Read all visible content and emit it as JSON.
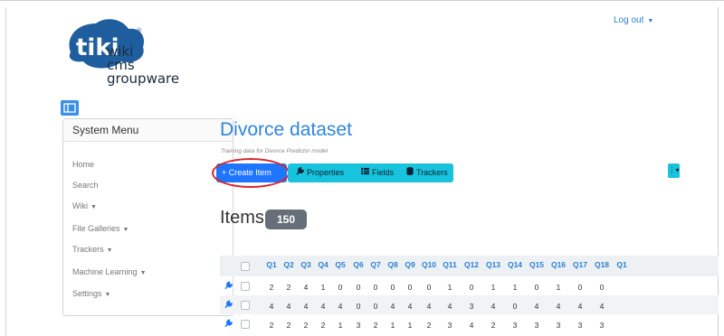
{
  "header": {
    "logout_label": "Log out"
  },
  "logo": {
    "brand": "tiki",
    "mark": "®",
    "lines": [
      "wiki",
      "cms",
      "groupware"
    ]
  },
  "sidebar": {
    "title": "System Menu",
    "items": [
      {
        "label": "Home",
        "has_caret": false
      },
      {
        "label": "Search",
        "has_caret": false
      },
      {
        "label": "Wiki",
        "has_caret": true
      },
      {
        "label": "File Galleries",
        "has_caret": true
      },
      {
        "label": "Trackers",
        "has_caret": true
      },
      {
        "label": "Machine Learning",
        "has_caret": true
      },
      {
        "label": "Settings",
        "has_caret": true
      }
    ]
  },
  "page": {
    "title": "Divorce dataset",
    "subtitle": "Training data for Divorce Predictor model"
  },
  "toolbar": {
    "create_label": "+ Create Item",
    "properties_label": "Properties",
    "fields_label": "Fields",
    "trackers_label": "Trackers"
  },
  "items": {
    "title": "Items",
    "count": "150"
  },
  "table": {
    "columns": [
      "Q1",
      "Q2",
      "Q3",
      "Q4",
      "Q5",
      "Q6",
      "Q7",
      "Q8",
      "Q9",
      "Q10",
      "Q11",
      "Q12",
      "Q13",
      "Q14",
      "Q15",
      "Q16",
      "Q17",
      "Q18",
      "Q1"
    ],
    "rows": [
      [
        "2",
        "2",
        "4",
        "1",
        "0",
        "0",
        "0",
        "0",
        "0",
        "0",
        "1",
        "0",
        "1",
        "1",
        "0",
        "1",
        "0",
        "0",
        ""
      ],
      [
        "4",
        "4",
        "4",
        "4",
        "4",
        "0",
        "0",
        "4",
        "4",
        "4",
        "4",
        "3",
        "4",
        "0",
        "4",
        "4",
        "4",
        "4",
        ""
      ],
      [
        "2",
        "2",
        "2",
        "2",
        "1",
        "3",
        "2",
        "1",
        "1",
        "2",
        "3",
        "4",
        "2",
        "3",
        "3",
        "3",
        "3",
        "3",
        ""
      ]
    ]
  },
  "colors": {
    "accent": "#2e86de",
    "primary_button": "#1f75fe",
    "info_button": "#17c3dd",
    "annotation_circle": "#d9262b",
    "badge": "#666f78"
  },
  "icons": {
    "sidebar_toggle": "sidebar-toggle-icon",
    "properties": "wrench-icon",
    "fields": "list-icon",
    "trackers": "database-icon",
    "row_action": "wrench-icon",
    "dropdown": "caret-down-icon"
  }
}
